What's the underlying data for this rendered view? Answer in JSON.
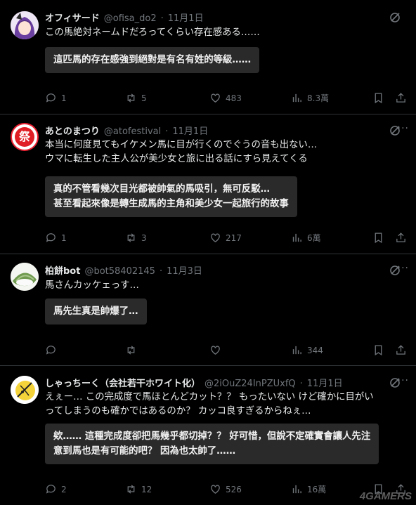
{
  "tweets": [
    {
      "name": "オフィサード",
      "handle": "@ofisa_do2",
      "date": "11月1日",
      "body": "この馬絶対ネームドだろってくらい存在感ある……",
      "translation": "這匹馬的存在感強到絕對是有名有姓的等級……",
      "replies": "1",
      "retweets": "5",
      "likes": "483",
      "views": "8.3萬"
    },
    {
      "name": "あとのまつり",
      "handle": "@atofestival",
      "date": "11月1日",
      "body": "本当に何度見てもイケメン馬に目が行くのでぐうの音も出ない…\nウマに転生した主人公が美少女と旅に出る話にすら見えてくる",
      "translation": "真的不管看幾次目光都被帥氣的馬吸引，無可反駁…\n甚至看起來像是轉生成馬的主角和美少女一起旅行的故事",
      "replies": "1",
      "retweets": "3",
      "likes": "217",
      "views": "6萬",
      "avatar_text": "祭"
    },
    {
      "name": "柏餅bot",
      "handle": "@bot58402145",
      "date": "11月3日",
      "body": "馬さんカッケェっす…",
      "translation": "馬先生真是帥爆了…",
      "replies": "",
      "retweets": "",
      "likes": "",
      "views": "344"
    },
    {
      "name": "しゃっちーく（会社若干ホワイト化）",
      "handle": "@2iOuZ24InPZUxfQ",
      "date": "11月1日",
      "body": "えぇー… この完成度で馬ほとんどカット？？ もったいない けど確かに目がい\nってしまうのも確かではあるのか？ カッコ良すぎるからねぇ…",
      "translation": "欸…… 這種完成度卻把馬幾乎都切掉？？ 好可惜，但說不定確實會讓人先注\n意到馬也是有可能的吧？ 因為也太帥了……",
      "replies": "2",
      "retweets": "12",
      "likes": "526",
      "views": "16萬"
    }
  ],
  "watermark": "4GAMERS",
  "colors": {
    "background": "#000000",
    "text": "#e7e9ea",
    "muted": "#71767b",
    "translation_bg": "#2a2a2a",
    "separator": "#2f3336"
  }
}
